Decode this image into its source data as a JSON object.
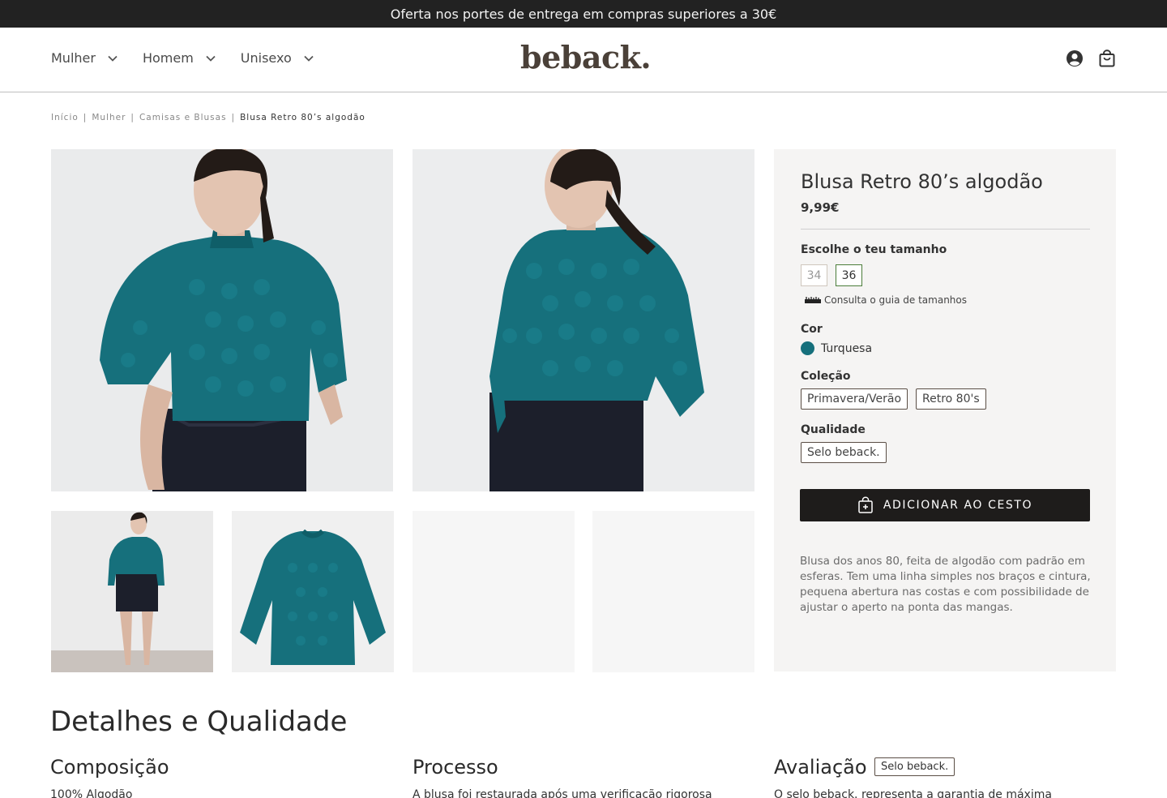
{
  "announcement": "Oferta nos portes de entrega em compras superiores a 30€",
  "nav": {
    "items": [
      {
        "label": "Mulher"
      },
      {
        "label": "Homem"
      },
      {
        "label": "Unisexo"
      }
    ]
  },
  "logo": "beback.",
  "header_icons": [
    "account-icon",
    "bag-icon"
  ],
  "breadcrumb": {
    "items": [
      "Início",
      "Mulher",
      "Camisas e Blusas"
    ],
    "current": "Blusa Retro 80’s algodão",
    "separator": "|"
  },
  "product": {
    "title": "Blusa Retro 80’s algodão",
    "price": "9,99€",
    "size_label": "Escolhe o teu tamanho",
    "sizes": [
      {
        "label": "34",
        "selected": false
      },
      {
        "label": "36",
        "selected": true
      }
    ],
    "size_guide": "Consulta o guia de tamanhos",
    "color_label": "Cor",
    "color_name": "Turquesa",
    "color_hex": "#16707c",
    "collection_label": "Coleção",
    "collections": [
      "Primavera/Verão",
      "Retro 80's"
    ],
    "quality_label": "Qualidade",
    "quality_tag": "Selo beback.",
    "add_to_cart": "ADICIONAR AO CESTO",
    "description": "Blusa dos anos 80, feita de algodão com padrão em esferas. Tem uma linha simples nos braços e cintura, pequena abertura nas costas e com possibilidade de ajustar o aperto na ponta das mangas."
  },
  "details": {
    "title": "Detalhes e Qualidade",
    "columns": [
      {
        "title": "Composição",
        "text": "100% Algodão"
      },
      {
        "title": "Processo",
        "text": "A blusa foi restaurada após uma verificação rigorosa"
      },
      {
        "title": "Avaliação",
        "tag": "Selo beback.",
        "text": "O selo beback. representa a garantia de máxima"
      }
    ]
  },
  "colors": {
    "topbar_bg": "#222222",
    "garment": "#16707c",
    "button_bg": "#1e1c1b",
    "panel_bg": "#f5f4f3",
    "selected_border": "#4b7d3a"
  }
}
